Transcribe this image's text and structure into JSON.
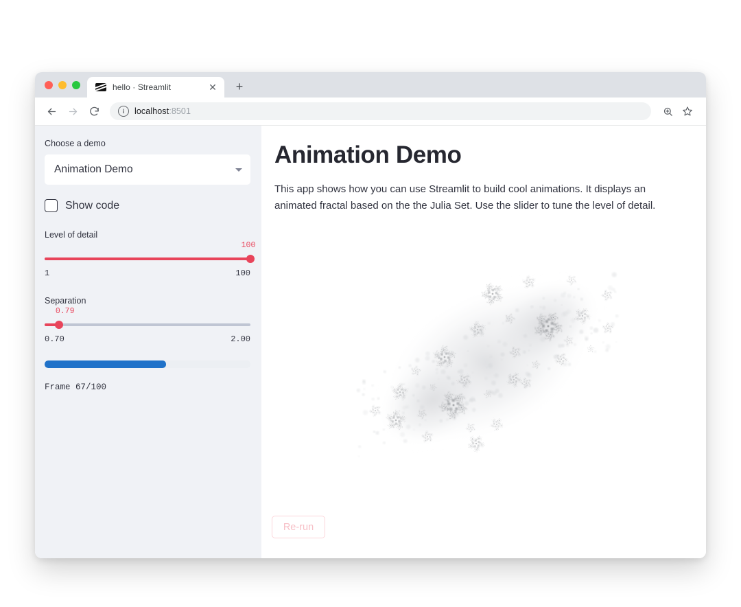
{
  "browser": {
    "tab": {
      "title": "hello · Streamlit",
      "favicon_name": "streamlit-favicon",
      "close_label": "✕"
    },
    "new_tab_label": "+",
    "nav": {
      "back": "←",
      "forward": "→",
      "reload": "⟳"
    },
    "omnibox": {
      "info_label": "i",
      "host": "localhost",
      "port": ":8501"
    },
    "tools": {
      "zoom_icon": "search-plus-icon",
      "bookmark_icon": "star-icon"
    }
  },
  "sidebar": {
    "select_label": "Choose a demo",
    "select_value": "Animation Demo",
    "checkbox_label": "Show code",
    "checkbox_checked": false,
    "sliders": [
      {
        "name": "level-of-detail",
        "label": "Level of detail",
        "value": "100",
        "min": "1",
        "max": "100",
        "percent": 100
      },
      {
        "name": "separation",
        "label": "Separation",
        "value": "0.79",
        "min": "0.70",
        "max": "2.00",
        "percent": 6.9
      }
    ],
    "progress": {
      "percent": 59,
      "color": "#2072c9"
    },
    "frame_text": "Frame 67/100"
  },
  "main": {
    "title": "Animation Demo",
    "description": "This app shows how you can use Streamlit to build cool animations. It displays an animated fractal based on the the Julia Set. Use the slider to tune the level of detail.",
    "fractal_name": "julia-set-fractal",
    "rerun_label": "Re-run"
  },
  "colors": {
    "accent_red": "#e8445a",
    "sidebar_bg": "#f0f2f6",
    "progress_blue": "#2072c9",
    "text_dark": "#31333f",
    "title_dark": "#262730"
  }
}
